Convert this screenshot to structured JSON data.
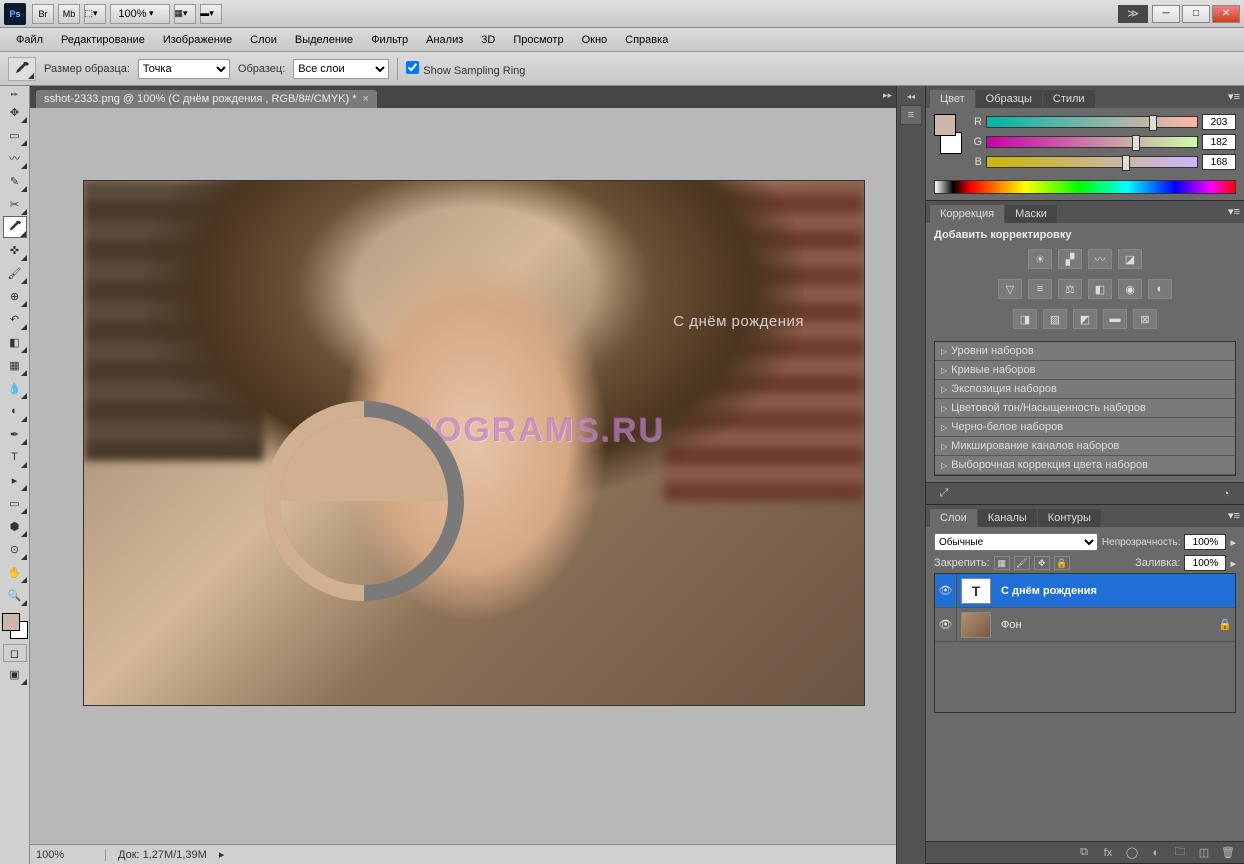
{
  "titlebar": {
    "zoom": "100%"
  },
  "menu": [
    "Файл",
    "Редактирование",
    "Изображение",
    "Слои",
    "Выделение",
    "Фильтр",
    "Анализ",
    "3D",
    "Просмотр",
    "Окно",
    "Справка"
  ],
  "options": {
    "size_label": "Размер образца:",
    "size_value": "Точка",
    "sample_label": "Образец:",
    "sample_value": "Все слои",
    "ring_label": "Show Sampling Ring"
  },
  "document": {
    "tab": "sshot-2333.png @ 100% (С днём рождения , RGB/8#/CMYK) *",
    "overlay_text": "С днём рождения",
    "watermark": "BOXPROGRAMS.RU"
  },
  "status": {
    "zoom": "100%",
    "doc": "Док: 1,27M/1,39M"
  },
  "color_panel": {
    "tabs": [
      "Цвет",
      "Образцы",
      "Стили"
    ],
    "r": 203,
    "g": 182,
    "b": 168
  },
  "adjust_panel": {
    "tabs": [
      "Коррекция",
      "Маски"
    ],
    "title": "Добавить корректировку",
    "presets": [
      "Уровни наборов",
      "Кривые наборов",
      "Экспозиция наборов",
      "Цветовой тон/Насыщенность наборов",
      "Черно-белое наборов",
      "Микширование каналов наборов",
      "Выборочная коррекция цвета наборов"
    ]
  },
  "layers_panel": {
    "tabs": [
      "Слои",
      "Каналы",
      "Контуры"
    ],
    "blend_label": "Обычные",
    "opacity_label": "Непрозрачность:",
    "opacity_value": "100%",
    "lock_label": "Закрепить:",
    "fill_label": "Заливка:",
    "fill_value": "100%",
    "layers": [
      {
        "name": "С днём рождения",
        "type": "text",
        "selected": true,
        "locked": false
      },
      {
        "name": "Фон",
        "type": "image",
        "selected": false,
        "locked": true
      }
    ]
  }
}
